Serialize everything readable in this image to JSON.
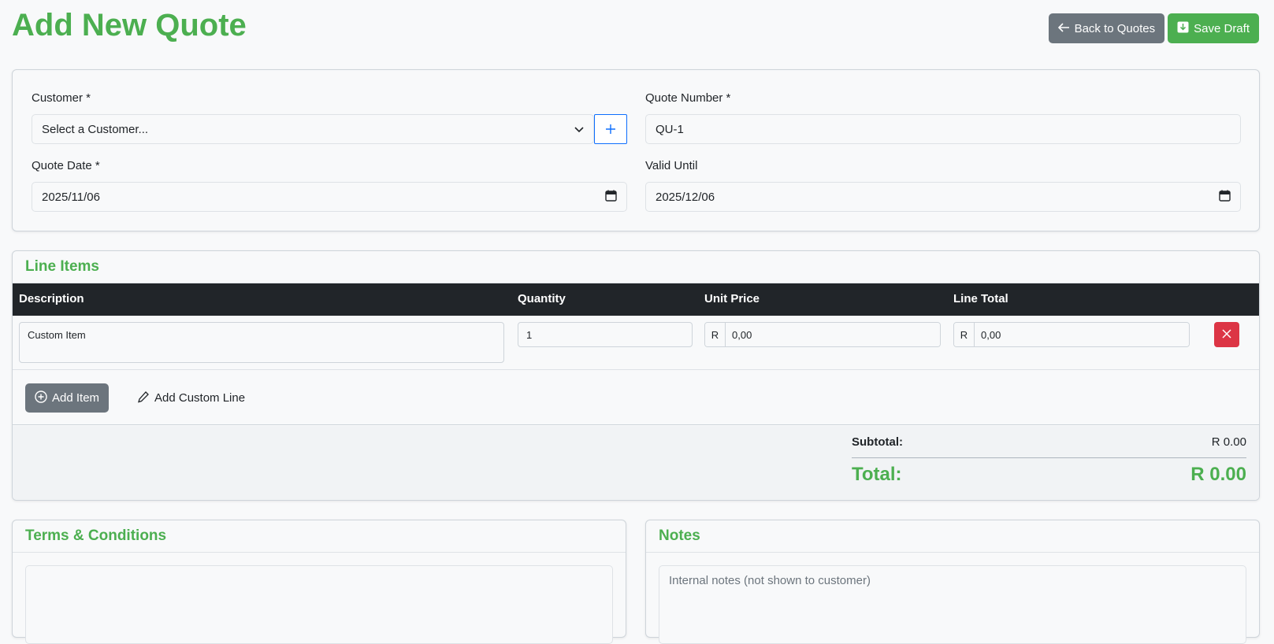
{
  "page": {
    "title": "Add New Quote"
  },
  "actions": {
    "back_label": "Back to Quotes",
    "save_label": "Save Draft"
  },
  "form": {
    "customer_label": "Customer *",
    "customer_value": "Select a Customer...",
    "quote_number_label": "Quote Number *",
    "quote_number_value": "QU-1",
    "quote_date_label": "Quote Date *",
    "quote_date_value": "2025/11/06",
    "valid_until_label": "Valid Until",
    "valid_until_value": "2025/12/06"
  },
  "line_items": {
    "title": "Line Items",
    "columns": [
      "Description",
      "Quantity",
      "Unit Price",
      "Line Total"
    ],
    "rows": [
      {
        "description": "Custom Item",
        "quantity": "1",
        "currency": "R",
        "unit_price": "0,00",
        "line_total": "0,00"
      }
    ],
    "add_item_label": "Add Item",
    "add_custom_label": "Add Custom Line"
  },
  "totals": {
    "subtotal_label": "Subtotal:",
    "subtotal_value": "R 0.00",
    "total_label": "Total:",
    "total_value": "R 0.00"
  },
  "terms": {
    "title": "Terms & Conditions"
  },
  "notes": {
    "title": "Notes",
    "placeholder": "Internal notes (not shown to customer)"
  },
  "colors": {
    "accent": "#4caf50",
    "danger": "#dc3545",
    "secondary": "#6c757d",
    "dark": "#212529",
    "primary": "#0d6efd"
  }
}
